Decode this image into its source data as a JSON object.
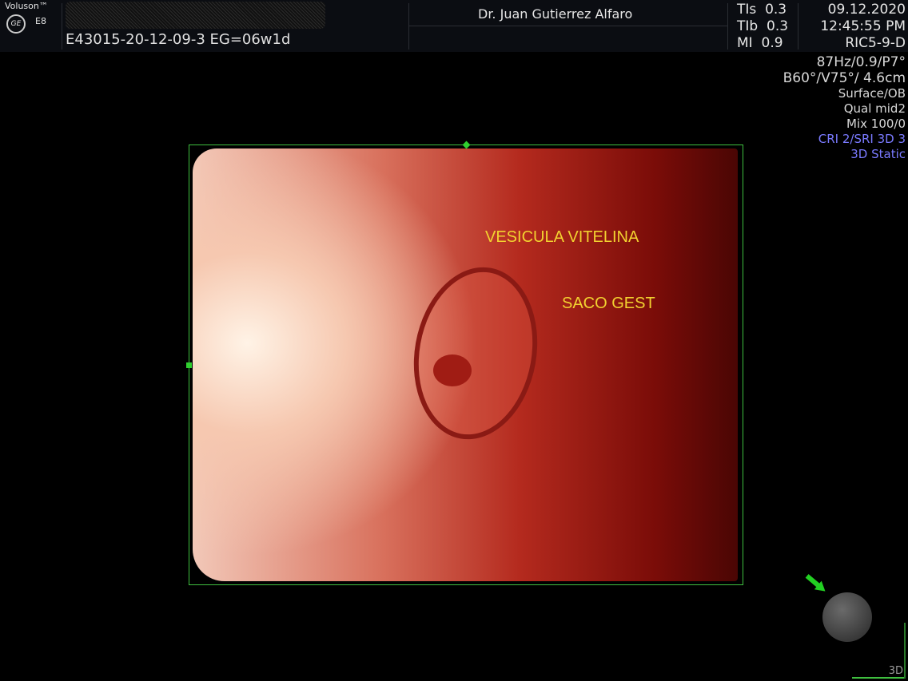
{
  "header": {
    "brand": "Voluson™",
    "model": "E8",
    "logo": "GE",
    "patient_id": "E43015-20-12-09-3  EG=06w1d",
    "doctor": "Dr. Juan Gutierrez Alfaro",
    "indices": [
      {
        "label": "TIs",
        "value": "0.3"
      },
      {
        "label": "TIb",
        "value": "0.3"
      },
      {
        "label": "MI",
        "value": "0.9"
      }
    ],
    "date": "09.12.2020",
    "time": "12:45:55 PM",
    "probe": "RIC5-9-D"
  },
  "params": [
    "87Hz/0.9/P7°",
    "B60°/V75°/ 4.6cm",
    "Surface/OB",
    "Qual mid2",
    "Mix 100/0"
  ],
  "params_blue": [
    "CRI 2/SRI 3D 3",
    "3D Static"
  ],
  "annotations": {
    "a1": "VESICULA VITELINA",
    "a2": "SACO GEST"
  },
  "mode_label": "3D",
  "colors": {
    "annotation": "#f2d230",
    "roi": "#3fbf3f",
    "blue": "#7a7aff"
  }
}
